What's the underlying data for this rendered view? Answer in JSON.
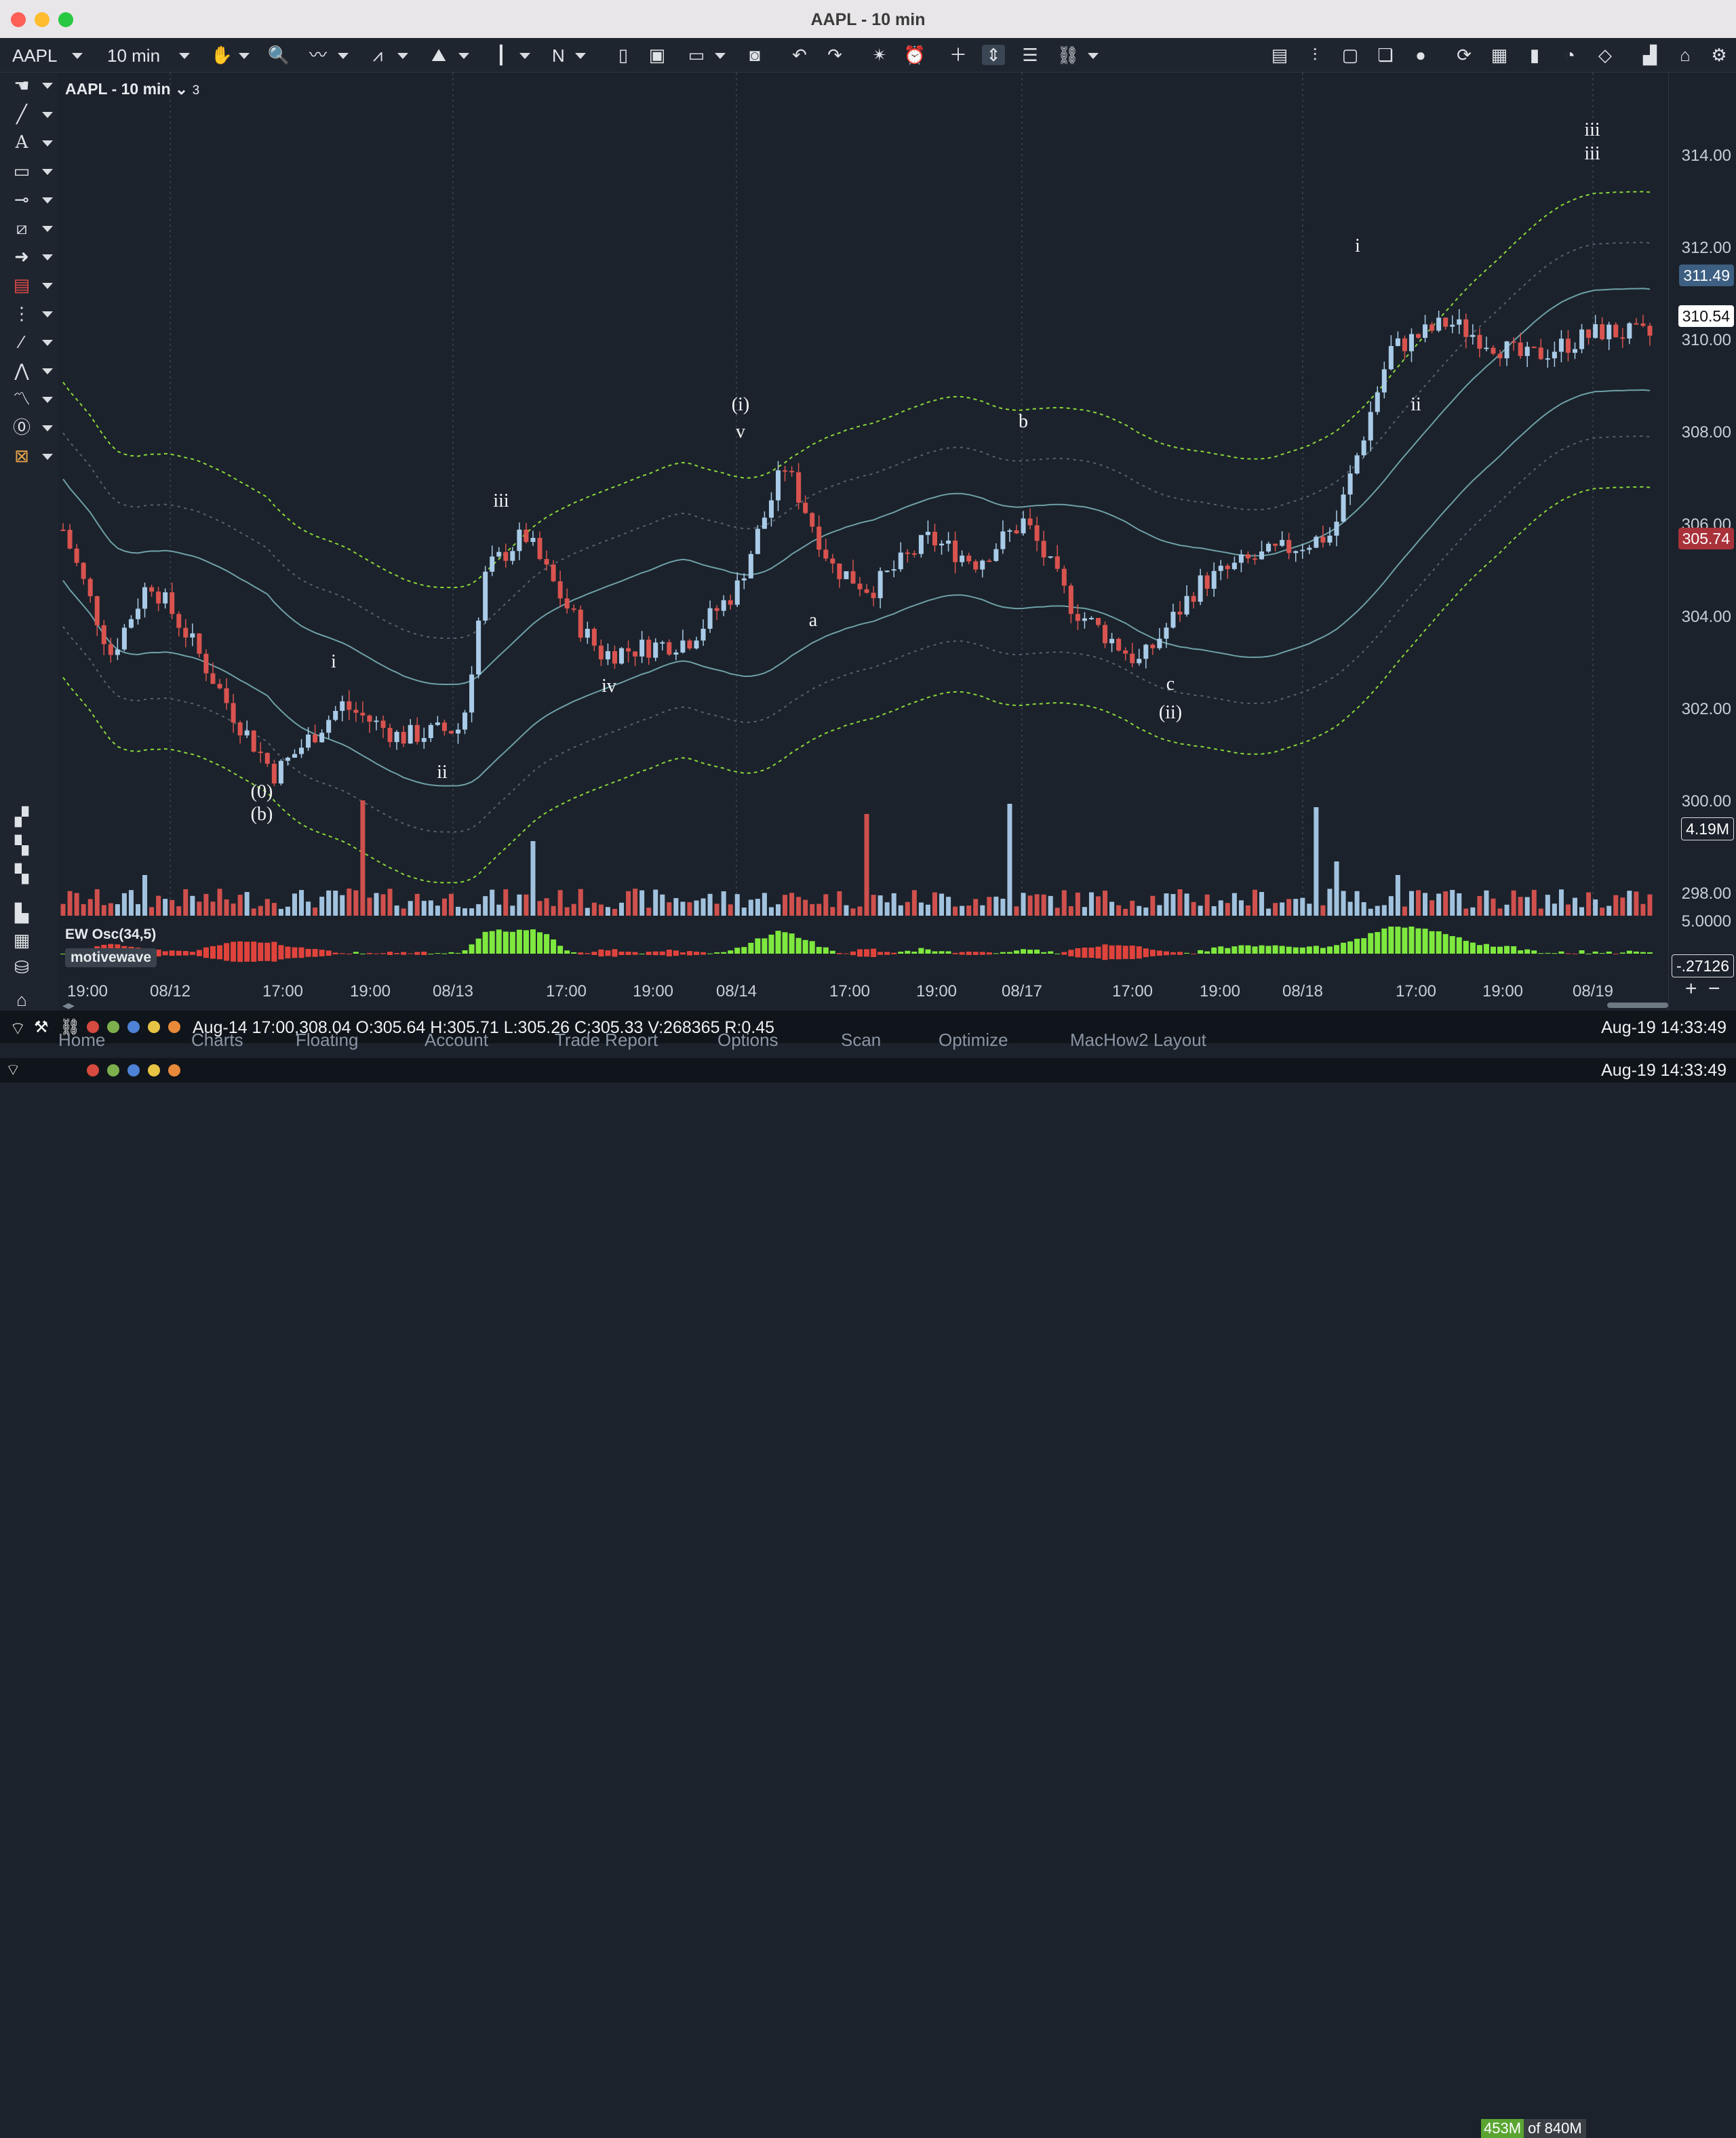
{
  "window": {
    "title": "AAPL - 10 min"
  },
  "toolbar": {
    "symbol": "AAPL",
    "interval": "10 min",
    "n_label": "N"
  },
  "chart": {
    "label": "AAPL - 10 min",
    "collapse_count": "3",
    "oscillator_label": "EW Osc(34,5)",
    "watermark": "motivewave",
    "price_axis": [
      "314.00",
      "312.00",
      "310.00",
      "308.00",
      "306.00",
      "304.00",
      "302.00",
      "300.00",
      "298.00"
    ],
    "osc_axis_top": "5.0000",
    "badges": {
      "upper_band": "311.49",
      "last_price": "310.54",
      "prior_close": "305.74",
      "volume": "4.19M",
      "osc_value": "-.27126"
    },
    "time_axis": [
      "19:00",
      "08/12",
      "17:00",
      "19:00",
      "08/13",
      "17:00",
      "19:00",
      "08/14",
      "17:00",
      "19:00",
      "08/17",
      "17:00",
      "19:00",
      "08/18",
      "17:00",
      "19:00",
      "08/19"
    ],
    "wave_labels": [
      "(0)",
      "(b)",
      "i",
      "ii",
      "iii",
      "iv",
      "(i)",
      "v",
      "a",
      "b",
      "c",
      "(ii)",
      "i",
      "ii",
      "iii",
      "iii"
    ],
    "colors": {
      "up": "#a9cbe8",
      "down": "#d9534f",
      "band_outer": "#8bd83a",
      "band_inner": "#6fa0a8",
      "osc_up": "#7ee83e",
      "osc_down": "#e0433c"
    }
  },
  "status": {
    "bar_info": "Aug-14 17:00,308.04 O:305.64 H:305.71 L:305.26 C:305.33 V:268365 R:0.45",
    "datetime": "Aug-19 14:33:49"
  },
  "tabs": [
    "Home",
    "Charts",
    "Floating",
    "Account",
    "Trade Report",
    "Options",
    "Scan",
    "Optimize",
    "MacHow2 Layout"
  ],
  "footer": {
    "mem_used": "453M",
    "mem_of": "of",
    "mem_total": "840M",
    "datetime": "Aug-19 14:33:49"
  }
}
